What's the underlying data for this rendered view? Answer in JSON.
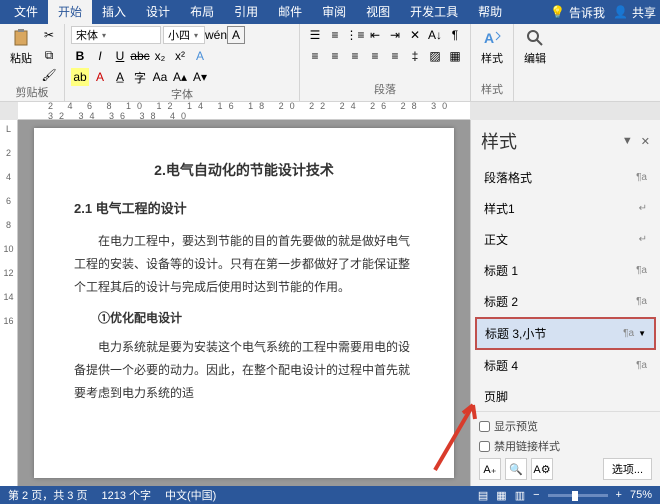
{
  "tabs": {
    "file": "文件",
    "home": "开始",
    "insert": "插入",
    "design": "设计",
    "layout": "布局",
    "references": "引用",
    "mail": "邮件",
    "review": "审阅",
    "view": "视图",
    "developer": "开发工具",
    "help": "帮助",
    "tell_me": "告诉我",
    "share": "共享"
  },
  "ribbon": {
    "clipboard": {
      "paste": "粘贴",
      "label": "剪贴板"
    },
    "font": {
      "name": "宋体",
      "size": "小四",
      "label": "字体",
      "bold": "B",
      "italic": "I",
      "underline": "U",
      "strike": "abc",
      "sub": "x₂",
      "sup": "x²"
    },
    "paragraph": {
      "label": "段落"
    },
    "styles": {
      "btn": "样式",
      "label": "样式"
    },
    "editing": {
      "btn": "编辑"
    }
  },
  "ruler_h": "2  4  6  8 10 12 14 16 18 20 22 24 26 28 30 32 34 36 38 40",
  "ruler_v": [
    "L",
    "",
    "2",
    "",
    "4",
    "",
    "6",
    "",
    "8",
    "",
    "10",
    "",
    "12",
    "",
    "14",
    "",
    "16"
  ],
  "document": {
    "h2": "2.电气自动化的节能设计技术",
    "h3": "2.1 电气工程的设计",
    "p1": "在电力工程中，要达到节能的目的首先要做的就是做好电气工程的安装、设备等的设计。只有在第一步都做好了才能保证整个工程其后的设计与完成后使用时达到节能的作用。",
    "h4": "①优化配电设计",
    "p2": "电力系统就是要为安装这个电气系统的工程中需要用电的设备提供一个必要的动力。因此，在整个配电设计的过程中首先就要考虑到电力系统的适"
  },
  "styles_pane": {
    "title": "样式",
    "items": [
      {
        "name": "段落格式",
        "marker": "¶a"
      },
      {
        "name": "样式1",
        "marker": "↵"
      },
      {
        "name": "正文",
        "marker": "↵"
      },
      {
        "name": "标题 1",
        "marker": "¶a"
      },
      {
        "name": "标题 2",
        "marker": "¶a"
      },
      {
        "name": "标题 3,小节",
        "marker": "¶a"
      },
      {
        "name": "标题 4",
        "marker": "¶a"
      },
      {
        "name": "页脚",
        "marker": ""
      }
    ],
    "highlighted_index": 5,
    "show_preview": "显示预览",
    "disable_linked": "禁用链接样式",
    "options": "选项..."
  },
  "statusbar": {
    "page": "第 2 页，共 3 页",
    "words": "1213 个字",
    "language": "中文(中国)",
    "zoom": "75%"
  }
}
